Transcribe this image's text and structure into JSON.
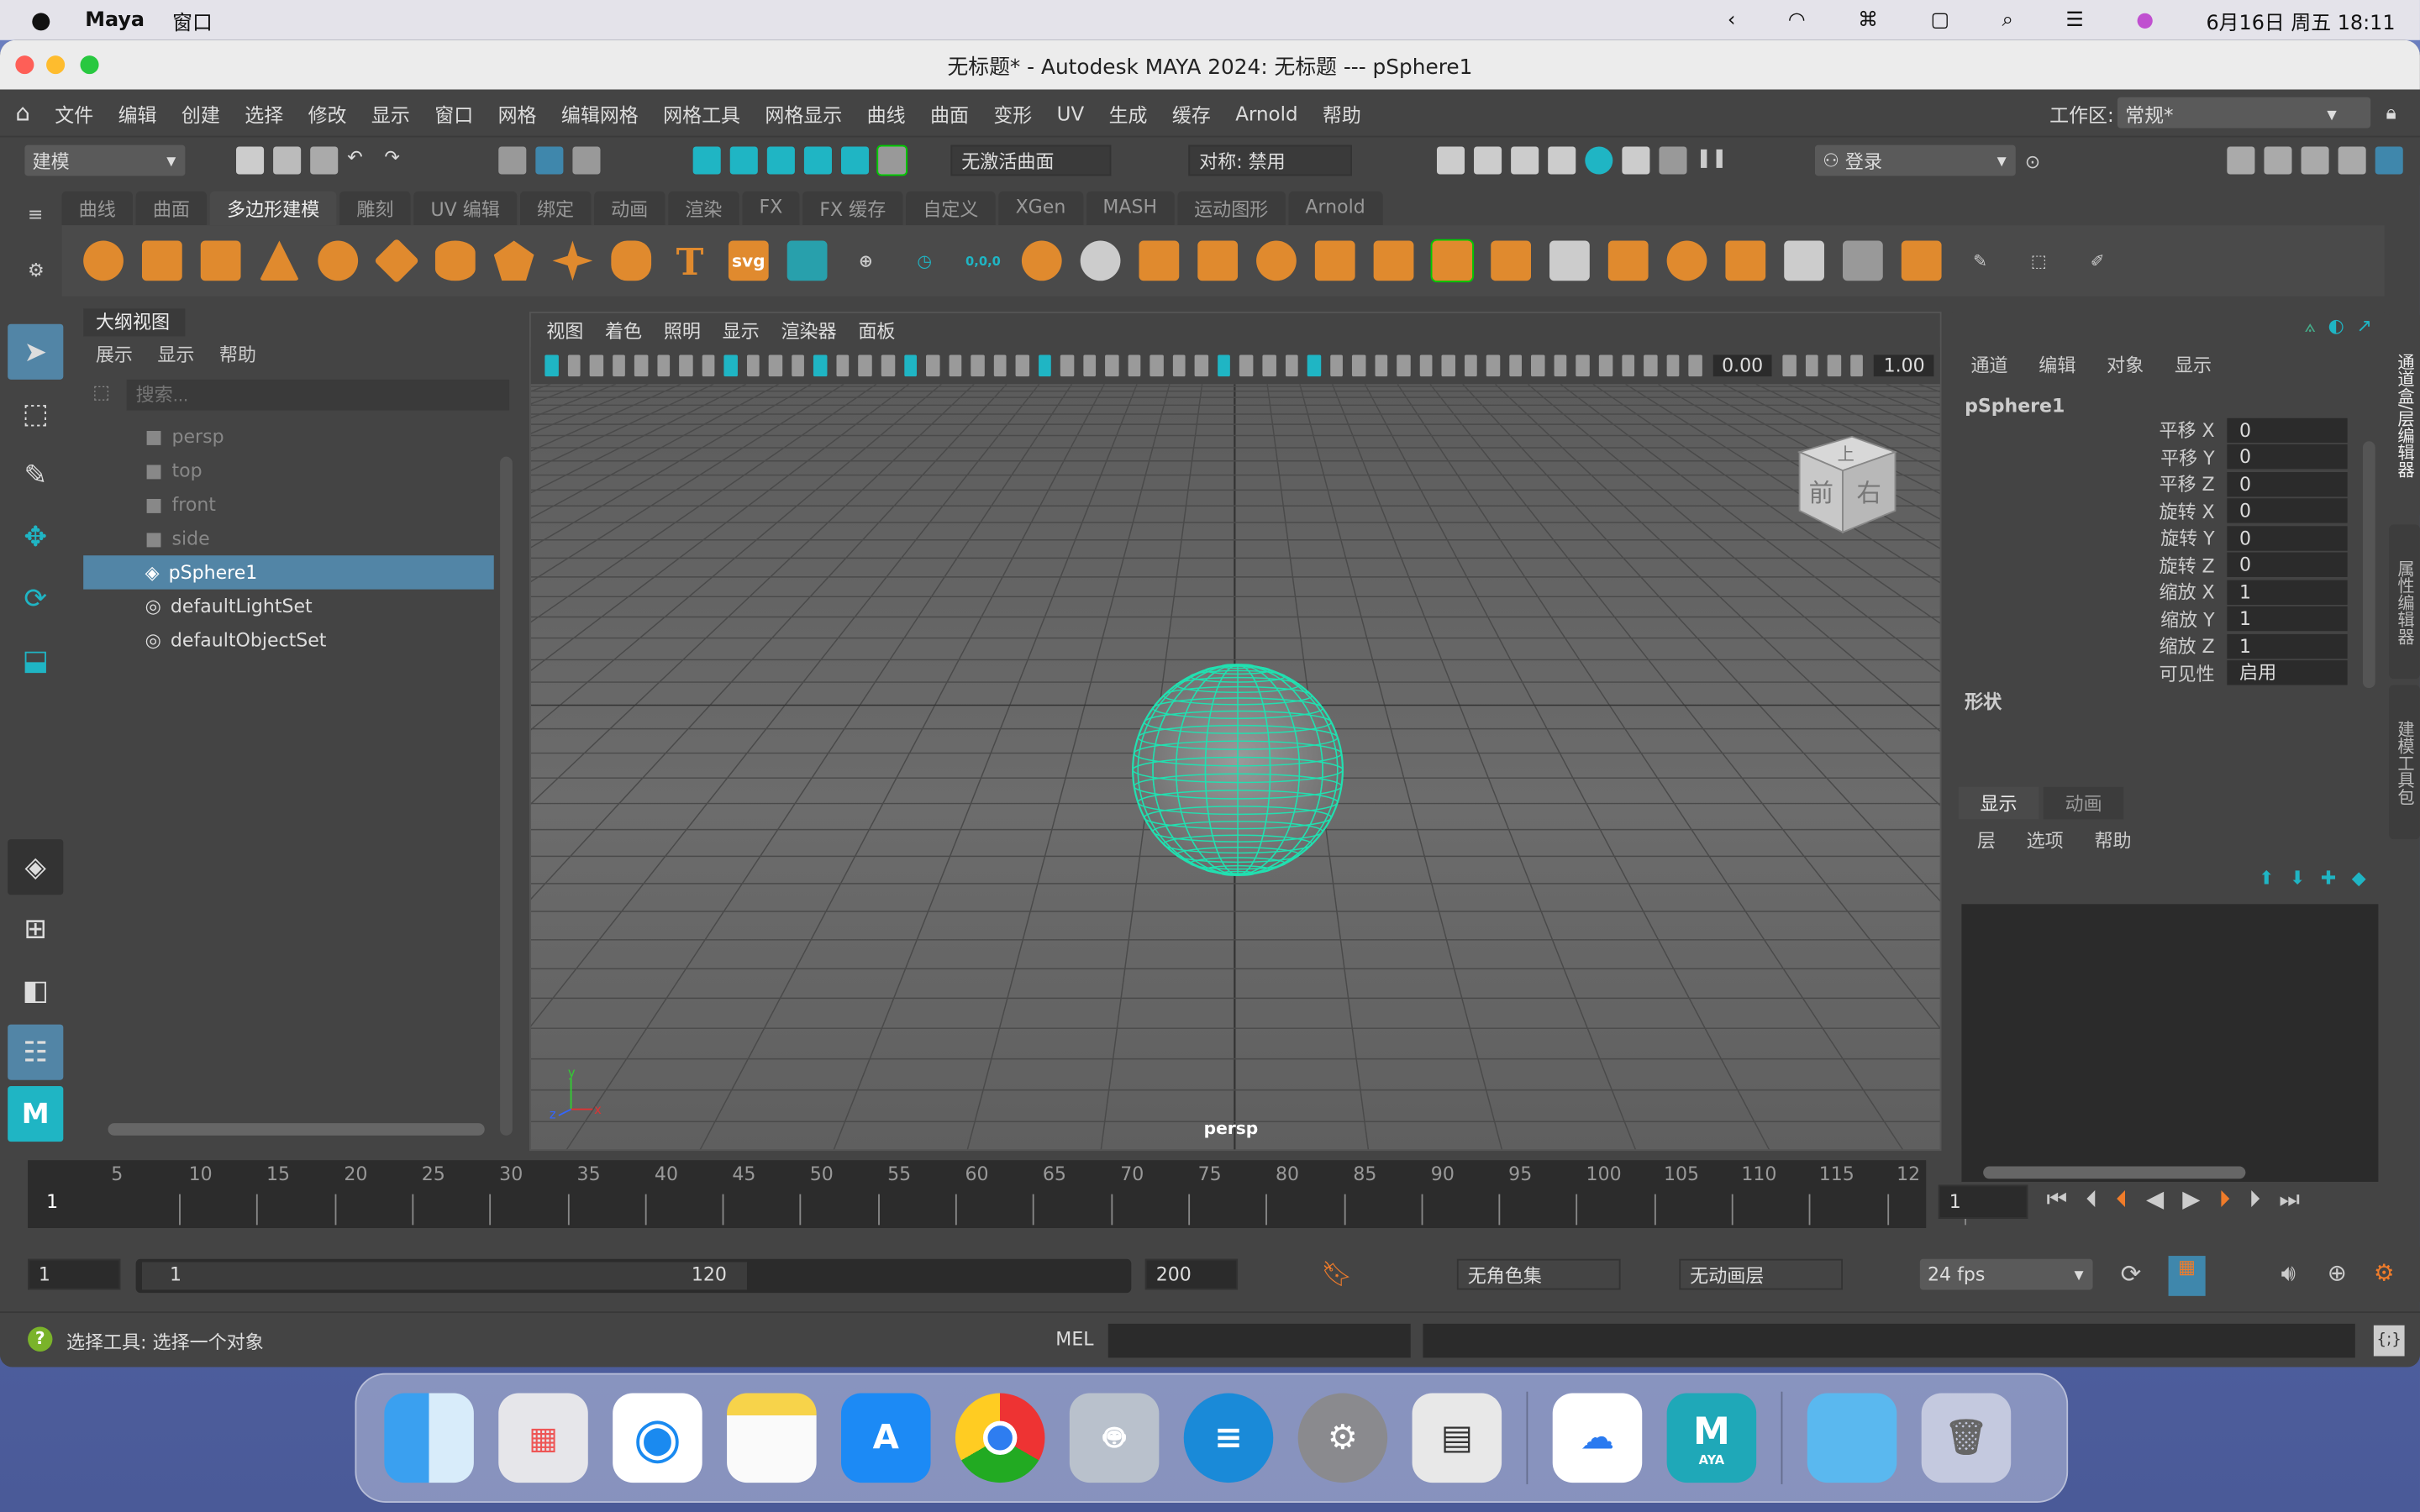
{
  "mac_menubar": {
    "app": "Maya",
    "items": [
      "窗口"
    ],
    "datetime": "6月16日 周五 18:11"
  },
  "window": {
    "title": "无标题* - Autodesk MAYA 2024: 无标题   ---   pSphere1"
  },
  "main_menu": [
    "文件",
    "编辑",
    "创建",
    "选择",
    "修改",
    "显示",
    "窗口",
    "网格",
    "编辑网格",
    "网格工具",
    "网格显示",
    "曲线",
    "曲面",
    "变形",
    "UV",
    "生成",
    "缓存",
    "Arnold",
    "帮助"
  ],
  "workspace": {
    "label": "工作区:",
    "value": "常规*"
  },
  "status_line": {
    "menu_set": "建模",
    "live_surface": "无激活曲面",
    "symmetry": "对称: 禁用",
    "login": "登录"
  },
  "shelf_tabs": [
    "曲线",
    "曲面",
    "多边形建模",
    "雕刻",
    "UV 编辑",
    "绑定",
    "动画",
    "渲染",
    "FX",
    "FX 缓存",
    "自定义",
    "XGen",
    "MASH",
    "运动图形",
    "Arnold"
  ],
  "shelf_active": "多边形建模",
  "shelf_text_icons": {
    "text": "T",
    "svg": "svg",
    "origin": "0,0,0"
  },
  "outliner": {
    "title": "大纲视图",
    "menu": [
      "展示",
      "显示",
      "帮助"
    ],
    "search_placeholder": "搜索...",
    "items": [
      {
        "name": "persp",
        "type": "camera"
      },
      {
        "name": "top",
        "type": "camera"
      },
      {
        "name": "front",
        "type": "camera"
      },
      {
        "name": "side",
        "type": "camera"
      },
      {
        "name": "pSphere1",
        "type": "mesh",
        "selected": true
      },
      {
        "name": "defaultLightSet",
        "type": "set"
      },
      {
        "name": "defaultObjectSet",
        "type": "set"
      }
    ]
  },
  "viewport": {
    "menu": [
      "视图",
      "着色",
      "照明",
      "显示",
      "渲染器",
      "面板"
    ],
    "exposure": "0.00",
    "gamma": "1.00",
    "camera_label": "persp",
    "viewcube": {
      "top": "上",
      "front": "前",
      "right": "右"
    },
    "axis": {
      "x": "x",
      "y": "y",
      "z": "z"
    }
  },
  "channel_box": {
    "menu": [
      "通道",
      "编辑",
      "对象",
      "显示"
    ],
    "object": "pSphere1",
    "channels": [
      {
        "label": "平移 X",
        "value": "0"
      },
      {
        "label": "平移 Y",
        "value": "0"
      },
      {
        "label": "平移 Z",
        "value": "0"
      },
      {
        "label": "旋转 X",
        "value": "0"
      },
      {
        "label": "旋转 Y",
        "value": "0"
      },
      {
        "label": "旋转 Z",
        "value": "0"
      },
      {
        "label": "缩放 X",
        "value": "1"
      },
      {
        "label": "缩放 Y",
        "value": "1"
      },
      {
        "label": "缩放 Z",
        "value": "1"
      },
      {
        "label": "可见性",
        "value": "启用"
      }
    ],
    "shapes_label": "形状"
  },
  "layer_editor": {
    "tabs": [
      "显示",
      "动画"
    ],
    "menu": [
      "层",
      "选项",
      "帮助"
    ]
  },
  "side_tabs": [
    "通道盒/层编辑器",
    "属性编辑器",
    "建模工具包"
  ],
  "timeline": {
    "ticks": [
      "5",
      "10",
      "15",
      "20",
      "25",
      "30",
      "35",
      "40",
      "45",
      "50",
      "55",
      "60",
      "65",
      "70",
      "75",
      "80",
      "85",
      "90",
      "95",
      "100",
      "105",
      "110",
      "115",
      "12"
    ],
    "current_frame": "1",
    "current_frame_field": "1"
  },
  "range": {
    "start": "1",
    "range_start": "1",
    "range_end": "120",
    "end": "200",
    "character_set": "无角色集",
    "anim_layer": "无动画层",
    "fps": "24 fps"
  },
  "command_line": {
    "help": "选择工具: 选择一个对象",
    "lang": "MEL"
  },
  "accent_color": "#1fb5c4",
  "selection_color": "#5285a6",
  "dock": [
    "Finder",
    "Launchpad",
    "Safari",
    "Notes",
    "App Store",
    "Chrome",
    "Automator",
    "Text",
    "System Settings",
    "Preview",
    "Baidu Netdisk",
    "Maya",
    "Folder",
    "Trash"
  ],
  "dock_maya_label": "AYA"
}
